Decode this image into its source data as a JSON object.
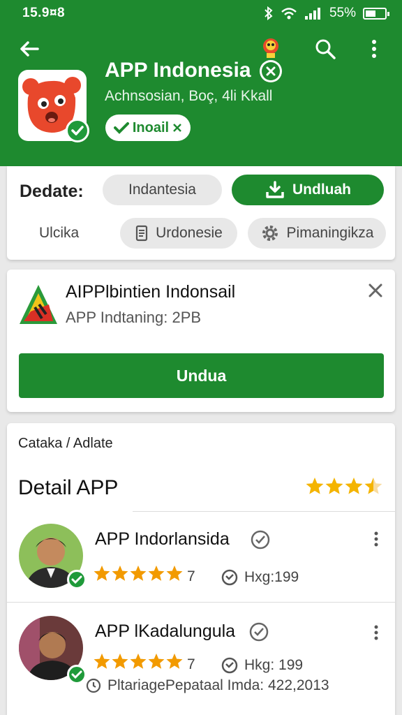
{
  "status_bar": {
    "time": "15.9¤8",
    "battery": "55%",
    "battery_level": 0.55
  },
  "header": {
    "app_title": "APP Indonesia",
    "subtitle": "Achnsosian,  Boç, 4li Kkall",
    "install_label": "Inoail",
    "colors": {
      "brand": "#1e8a2f",
      "star": "#f4b400"
    }
  },
  "update_card": {
    "label": "Dedate:",
    "chip_lang": "Indantesia",
    "chip_download": "Undluah",
    "small_label": "Ulcika",
    "chip_doc": "Urdonesie",
    "chip_settings": "Pimaningikza"
  },
  "promo_card": {
    "title": "AIPPlbintien Indonsail",
    "subtitle": "APP Indtaning: 2PB",
    "button": "Undua"
  },
  "detail_card": {
    "breadcrumb": "Cataka / Adlate",
    "title": "Detail APP",
    "rating_stars": 3.5,
    "reviews": [
      {
        "name": "APP Indorlansida",
        "stars": 5,
        "count": "7",
        "hkg": "Hxg:199"
      },
      {
        "name": "APP lKadalungula",
        "stars": 5,
        "count": "7",
        "hkg": "Hkg: 199",
        "footer": "PltariagePepataal Imda: 422,2013"
      }
    ]
  },
  "icons": [
    "back-icon",
    "mascot-icon",
    "search-icon",
    "more-icon",
    "close-icon",
    "download-icon",
    "document-icon",
    "gear-icon",
    "check-icon",
    "clock-icon"
  ]
}
